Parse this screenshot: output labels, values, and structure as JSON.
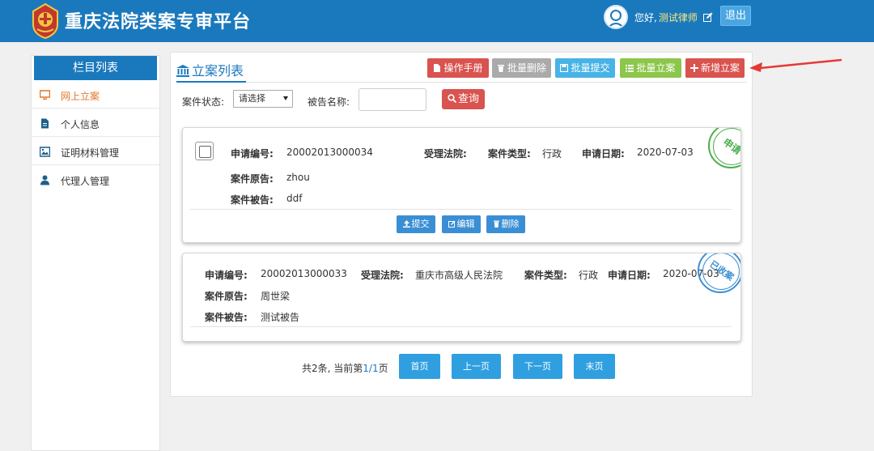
{
  "header": {
    "title": "重庆法院类案专审平台",
    "greeting": "您好,",
    "username": "测试律师",
    "logout": "退出"
  },
  "sidebar": {
    "title": "栏目列表",
    "items": [
      {
        "label": "网上立案",
        "icon": "monitor-icon",
        "active": true
      },
      {
        "label": "个人信息",
        "icon": "document-icon"
      },
      {
        "label": "证明材料管理",
        "icon": "image-icon"
      },
      {
        "label": "代理人管理",
        "icon": "user-icon"
      }
    ]
  },
  "main": {
    "title": "立案列表",
    "toolbar": {
      "manual": "操作手册",
      "batch_delete": "批量删除",
      "batch_submit": "批量提交",
      "batch_file": "批量立案",
      "new_case": "新增立案"
    },
    "filter": {
      "status_label": "案件状态:",
      "status_value": "请选择",
      "name_label": "被告名称:",
      "name_value": "",
      "search": "查询"
    },
    "labels": {
      "app_no": "申请编号:",
      "court": "受理法院:",
      "case_type": "案件类型:",
      "apply_date": "申请日期:",
      "plaintiff": "案件原告:",
      "defendant": "案件被告:"
    },
    "cases": [
      {
        "app_no": "20002013000034",
        "court": "",
        "case_type": "行政",
        "apply_date": "2020-07-03",
        "plaintiff": "zhou",
        "defendant": "ddf",
        "stamp": "申请",
        "actions": {
          "submit": "提交",
          "edit": "编辑",
          "delete": "删除"
        }
      },
      {
        "app_no": "20002013000033",
        "court": "重庆市高级人民法院",
        "case_type": "行政",
        "apply_date": "2020-07-03",
        "plaintiff": "周世梁",
        "defendant": "测试被告",
        "stamp": "已收案"
      }
    ],
    "pagination": {
      "prefix": "共2条, 当前第",
      "current": "1",
      "total": "/1",
      "suffix": "页",
      "first": "首页",
      "prev": "上一页",
      "next": "下一页",
      "last": "末页"
    }
  },
  "colors": {
    "brand": "#1a79bd",
    "danger": "#d9534f",
    "success": "#8cc64a",
    "info": "#48b3e6",
    "disabled": "#aaaaaa",
    "stamp_green": "#4cae4c",
    "stamp_blue": "#3a8fd4"
  }
}
